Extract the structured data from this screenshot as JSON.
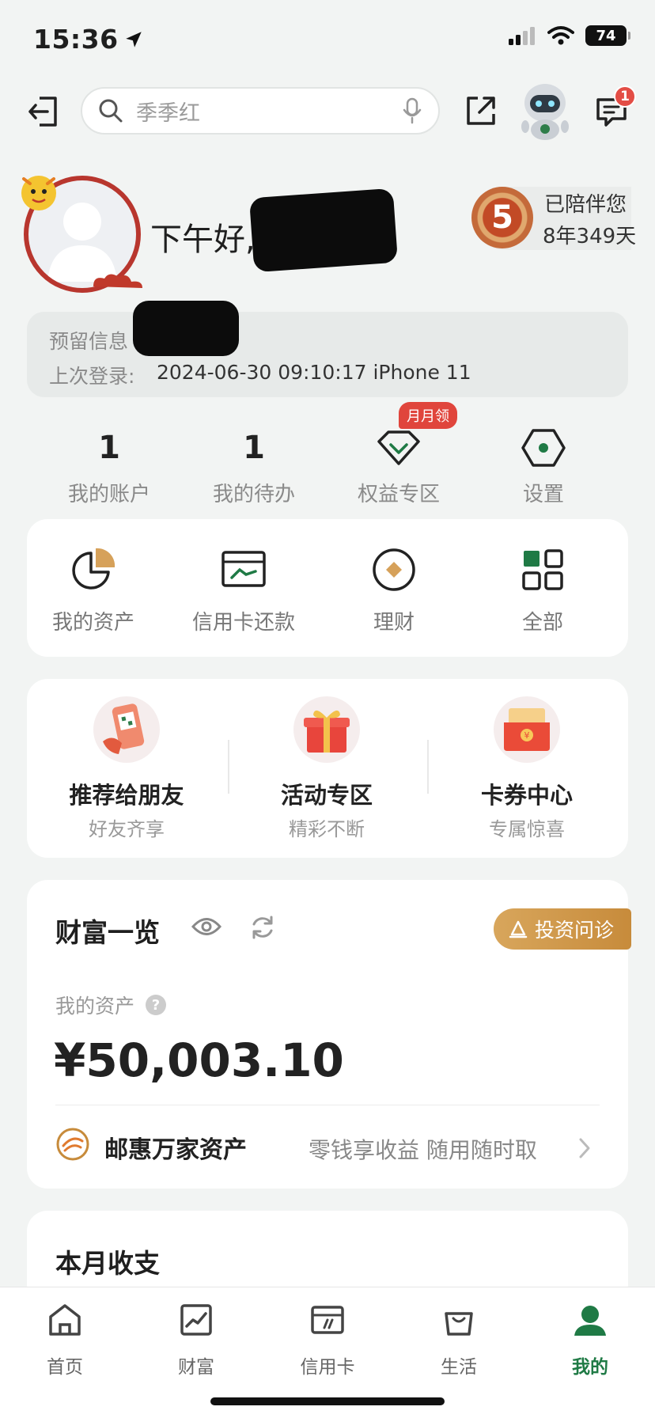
{
  "status_bar": {
    "time": "15:36",
    "battery": "74"
  },
  "search": {
    "placeholder": "季季红"
  },
  "messages": {
    "badge_count": "1"
  },
  "greeting": {
    "text": "下午好,"
  },
  "companion": {
    "medal_number": "5",
    "line1": "已陪伴您",
    "line2": "8年349天"
  },
  "info": {
    "reserved_label": "预留信息",
    "last_login_label": "上次登录:",
    "last_login_value": "2024-06-30 09:10:17 iPhone 11"
  },
  "quick_row": [
    {
      "value": "1",
      "label": "我的账户"
    },
    {
      "value": "1",
      "label": "我的待办"
    },
    {
      "label": "权益专区",
      "badge": "月月领"
    },
    {
      "label": "设置"
    }
  ],
  "functions": [
    {
      "label": "我的资产",
      "icon": "pie-chart-icon"
    },
    {
      "label": "信用卡还款",
      "icon": "card-payment-icon"
    },
    {
      "label": "理财",
      "icon": "finance-icon"
    },
    {
      "label": "全部",
      "icon": "grid-icon"
    }
  ],
  "promos": [
    {
      "title": "推荐给朋友",
      "subtitle": "好友齐享"
    },
    {
      "title": "活动专区",
      "subtitle": "精彩不断"
    },
    {
      "title": "卡券中心",
      "subtitle": "专属惊喜"
    }
  ],
  "wealth": {
    "title": "财富一览",
    "invest_button": "投资问诊",
    "asset_label": "我的资产",
    "asset_amount": "¥50,003.10",
    "product_name": "邮惠万家资产",
    "product_desc": "零钱享收益 随用随时取"
  },
  "monthly": {
    "title": "本月收支"
  },
  "bottom_nav": [
    {
      "label": "首页"
    },
    {
      "label": "财富"
    },
    {
      "label": "信用卡"
    },
    {
      "label": "生活"
    },
    {
      "label": "我的"
    }
  ],
  "colors": {
    "brand_green": "#1f7a45",
    "badge_red": "#e34d45",
    "gold": "#c78b3b"
  }
}
